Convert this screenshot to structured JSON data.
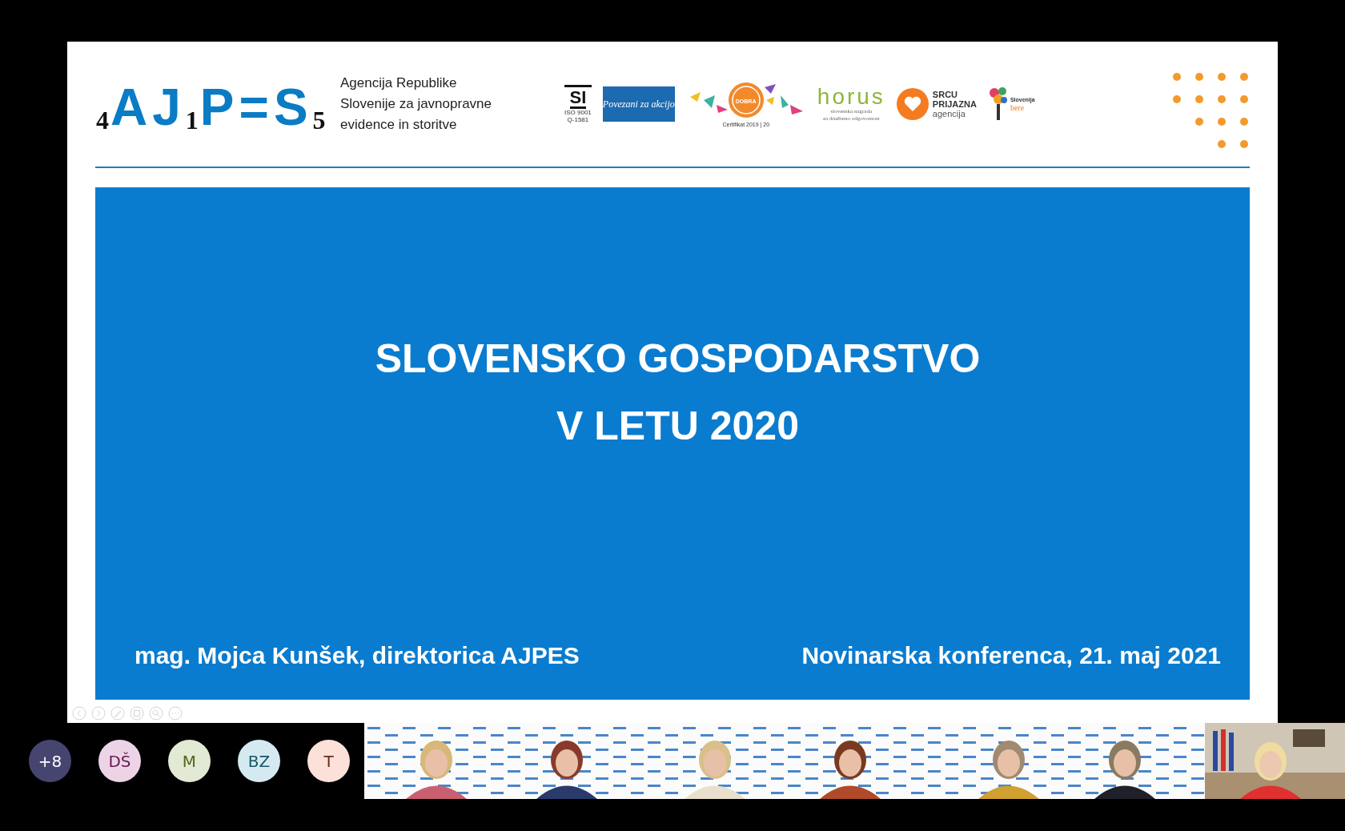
{
  "slide": {
    "logo": {
      "glyphs": [
        {
          "kind": "digit",
          "text": "4"
        },
        {
          "kind": "letter",
          "text": "A"
        },
        {
          "kind": "letter",
          "text": "J"
        },
        {
          "kind": "digit",
          "text": "1"
        },
        {
          "kind": "letter",
          "text": "P"
        },
        {
          "kind": "letter",
          "text": "="
        },
        {
          "kind": "letter",
          "text": "S"
        },
        {
          "kind": "digit",
          "text": "5"
        }
      ]
    },
    "agency_name": [
      "Agencija Republike",
      "Slovenije za javnopravne",
      "evidence in storitve"
    ],
    "partner_logos": [
      {
        "kind": "iso",
        "lines": [
          "SI",
          "ISO 9001",
          "Q-1581"
        ]
      },
      {
        "kind": "banner",
        "lines": [
          "Povezani za akcijo"
        ]
      },
      {
        "kind": "badge",
        "lines": [
          "DOBRA",
          "Certifikat 2019 | 20"
        ]
      },
      {
        "kind": "horus",
        "lines": [
          "horus",
          "slovenska nagrada",
          "za družbeno odgovornost"
        ]
      },
      {
        "kind": "heart",
        "lines": [
          "SRCU",
          "PRIJAZNA",
          "agencija"
        ]
      },
      {
        "kind": "reading",
        "lines": [
          "Slovenija",
          "bere"
        ]
      }
    ],
    "title": [
      "SLOVENSKO GOSPODARSTVO",
      "V LETU 2020"
    ],
    "presenter": "mag. Mojca Kunšek, direktorica AJPES",
    "event": "Novinarska konferenca, 21. maj 2021"
  },
  "slide_controls": [
    {
      "kind": "previous"
    },
    {
      "kind": "next"
    },
    {
      "kind": "pen"
    },
    {
      "kind": "slides"
    },
    {
      "kind": "zoom"
    },
    {
      "kind": "more"
    }
  ],
  "participants": [
    {
      "initials": "+8",
      "color": "#454570"
    },
    {
      "initials": "DŠ",
      "color": "#ecd4e6"
    },
    {
      "initials": "M",
      "color": "#e2e9d4"
    },
    {
      "initials": "BZ",
      "color": "#d5eaf0"
    },
    {
      "initials": "T",
      "color": "#fbe1d8"
    }
  ],
  "videos": [
    {
      "kind": "picture"
    },
    {
      "kind": "picture"
    },
    {
      "kind": "picture"
    },
    {
      "kind": "picture"
    },
    {
      "kind": "picture"
    },
    {
      "kind": "picture"
    },
    {
      "kind": "room"
    }
  ]
}
